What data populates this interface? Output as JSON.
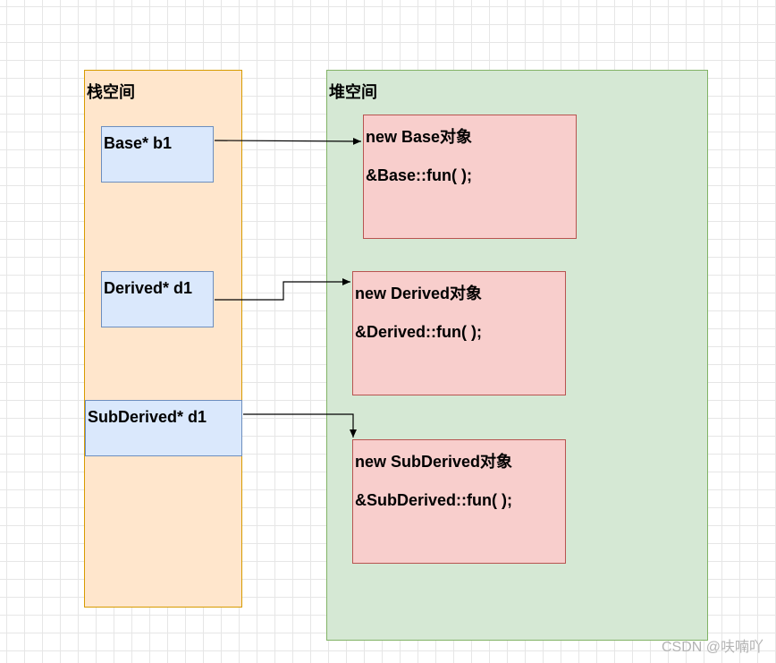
{
  "stack": {
    "title": "栈空间",
    "pointers": [
      {
        "label": "Base* b1"
      },
      {
        "label": "Derived* d1"
      },
      {
        "label": "SubDerived* d1"
      }
    ]
  },
  "heap": {
    "title": "堆空间",
    "objects": [
      {
        "line1": "new Base对象",
        "line2": "&Base::fun( );"
      },
      {
        "line1": "new Derived对象",
        "line2": "&Derived::fun( );"
      },
      {
        "line1": "new SubDerived对象",
        "line2": "&SubDerived::fun( );"
      }
    ]
  },
  "watermark": "CSDN @呋喃吖",
  "colors": {
    "stack_fill": "#ffe6cc",
    "stack_border": "#d79b00",
    "heap_fill": "#d5e8d4",
    "heap_border": "#82b366",
    "pointer_fill": "#dae8fc",
    "pointer_border": "#6c8ebf",
    "object_fill": "#f8cecc",
    "object_border": "#b85450"
  }
}
